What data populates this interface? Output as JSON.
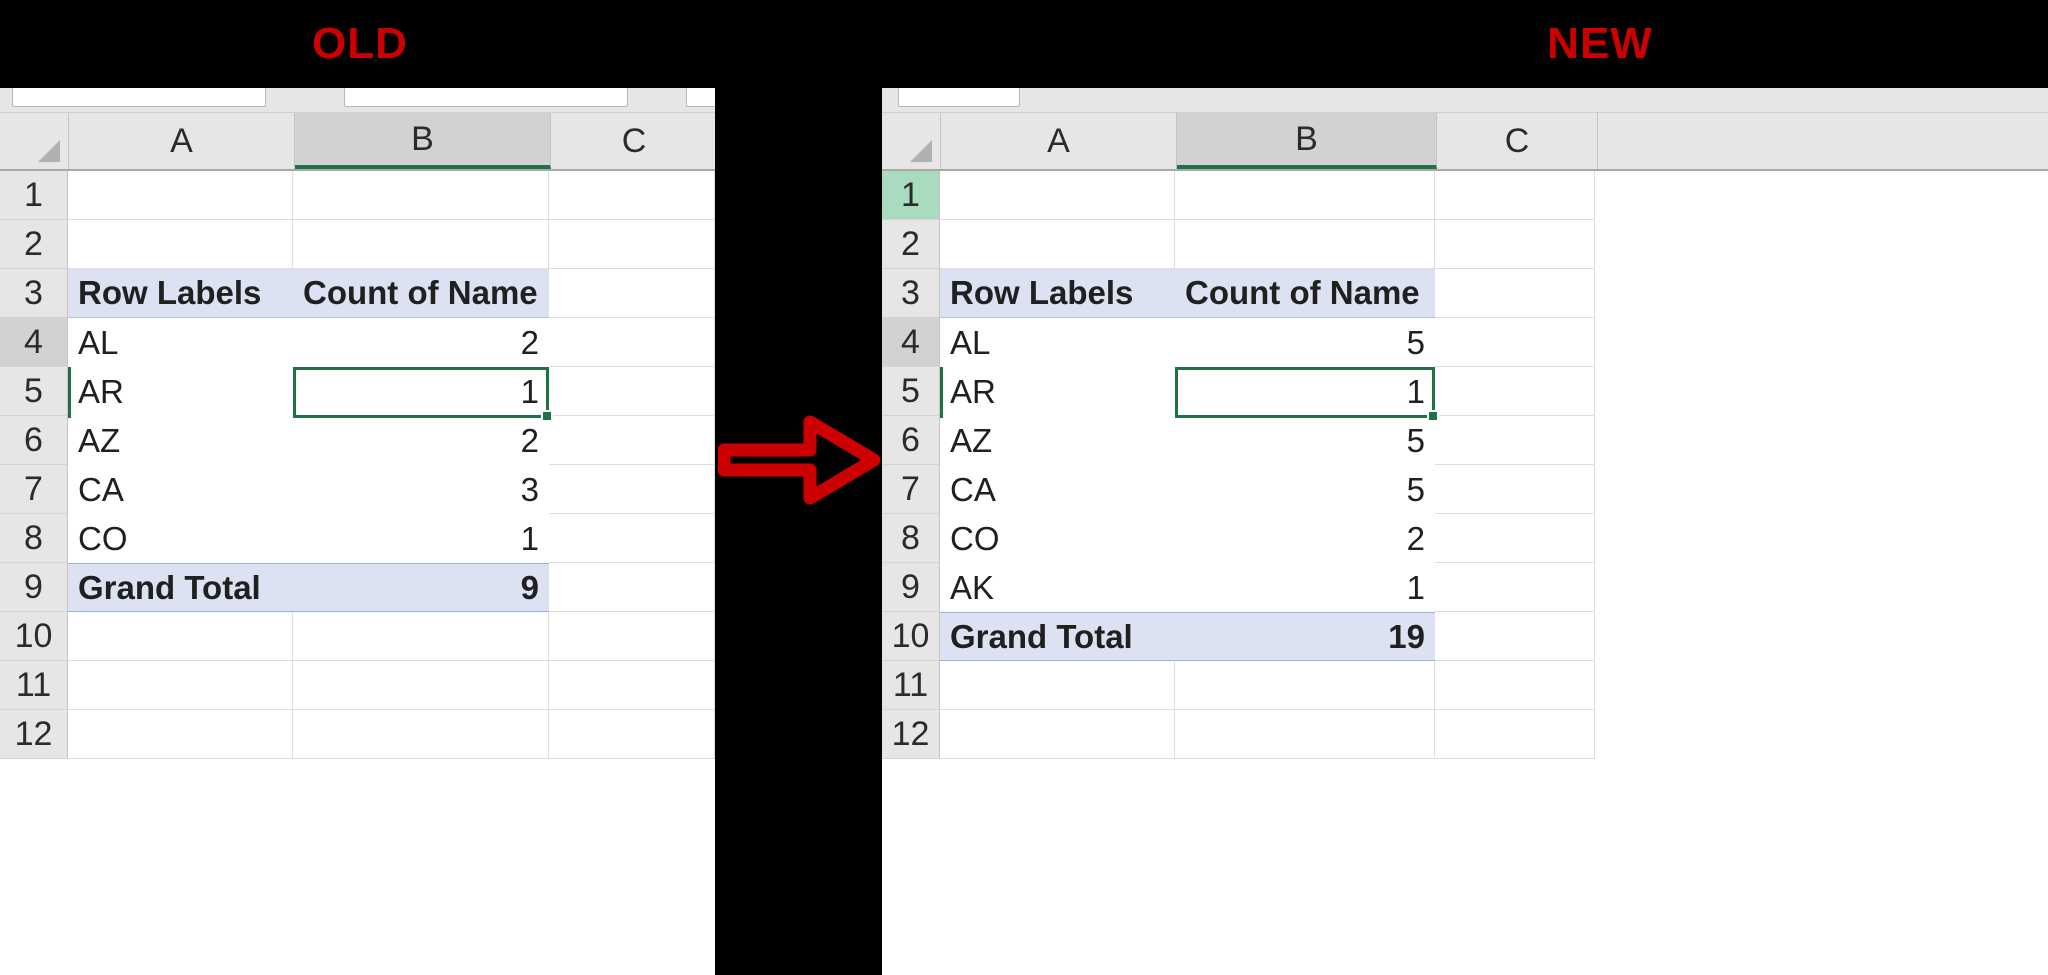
{
  "captions": {
    "old": "OLD",
    "new": "NEW",
    "color": "#cc0000"
  },
  "arrow": {
    "name": "right-arrow",
    "color": "#cc0000",
    "direction": "right"
  },
  "panes": [
    {
      "id": "old",
      "caption": "OLD",
      "column_headers": [
        "A",
        "B",
        "C"
      ],
      "selected_column": "B",
      "row_numbers": [
        "1",
        "2",
        "3",
        "4",
        "5",
        "6",
        "7",
        "8",
        "9",
        "10",
        "11",
        "12"
      ],
      "active_row": "4",
      "active_cell": "B4",
      "pivot": {
        "header_row": "3",
        "row_labels_header": "Row Labels",
        "value_header": "Count of Name",
        "filter_icon": "filter-dropdown-icon",
        "rows": [
          {
            "row": "4",
            "label": "AL",
            "value": "2"
          },
          {
            "row": "5",
            "label": "AR",
            "value": "1"
          },
          {
            "row": "6",
            "label": "AZ",
            "value": "2"
          },
          {
            "row": "7",
            "label": "CA",
            "value": "3"
          },
          {
            "row": "8",
            "label": "CO",
            "value": "1"
          }
        ],
        "total_row": "9",
        "total_label": "Grand Total",
        "total_value": "9"
      }
    },
    {
      "id": "new",
      "caption": "NEW",
      "column_headers": [
        "A",
        "B",
        "C"
      ],
      "selected_column": "B",
      "row_numbers": [
        "1",
        "2",
        "3",
        "4",
        "5",
        "6",
        "7",
        "8",
        "9",
        "10",
        "11",
        "12"
      ],
      "active_row": "4",
      "active_cell": "B4",
      "highlighted_row": "1",
      "pivot": {
        "header_row": "3",
        "row_labels_header": "Row Labels",
        "value_header": "Count of Name",
        "filter_icon": "filter-dropdown-icon",
        "rows": [
          {
            "row": "4",
            "label": "AL",
            "value": "5"
          },
          {
            "row": "5",
            "label": "AR",
            "value": "1"
          },
          {
            "row": "6",
            "label": "AZ",
            "value": "5"
          },
          {
            "row": "7",
            "label": "CA",
            "value": "5"
          },
          {
            "row": "8",
            "label": "CO",
            "value": "2"
          },
          {
            "row": "9",
            "label": "AK",
            "value": "1"
          }
        ],
        "total_row": "10",
        "total_label": "Grand Total",
        "total_value": "19"
      }
    }
  ],
  "chart_data": {
    "type": "table",
    "title": "PivotTable comparison: OLD vs NEW",
    "categories": [
      "AL",
      "AR",
      "AZ",
      "CA",
      "CO",
      "AK"
    ],
    "series": [
      {
        "name": "OLD - Count of Name",
        "values": [
          2,
          1,
          2,
          3,
          1,
          null
        ],
        "total": 9
      },
      {
        "name": "NEW - Count of Name",
        "values": [
          5,
          1,
          5,
          5,
          2,
          1
        ],
        "total": 19
      }
    ],
    "xlabel": "Row Labels",
    "ylabel": "Count of Name"
  }
}
